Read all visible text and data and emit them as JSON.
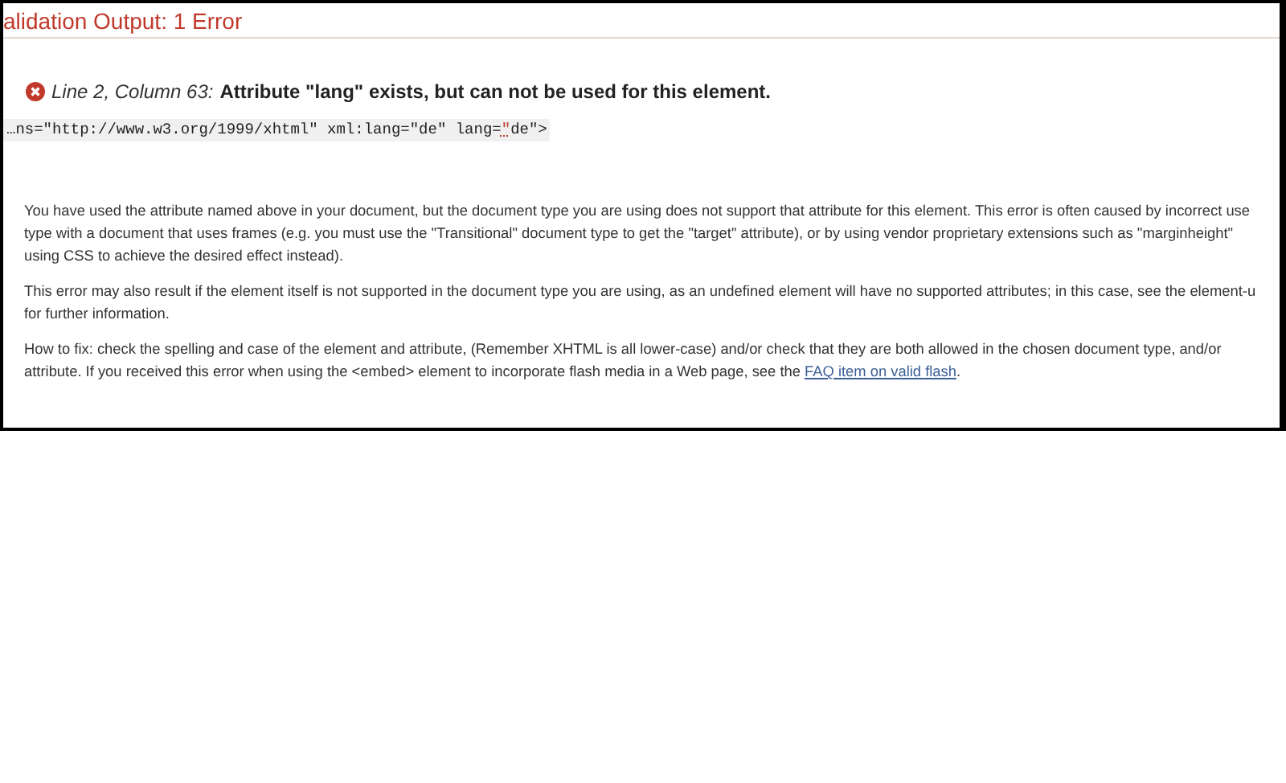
{
  "panel": {
    "title": "alidation Output: 1 Error"
  },
  "error": {
    "location": "Line 2, Column 63:",
    "message": "Attribute \"lang\" exists, but can not be used for this element.",
    "code_before": "…ns=\"http://www.w3.org/1999/xhtml\" xml:lang=\"de\" lang=",
    "code_highlight": "\"",
    "code_after": "de\">"
  },
  "paragraphs": [
    {
      "lines": [
        "You have used the attribute named above in your document, but the document type you are using does not support that attribute for this element. This error is often caused by incorrect use",
        "type with a document that uses frames (e.g. you must use the \"Transitional\" document type to get the \"target\" attribute), or by using vendor proprietary extensions such as \"marginheight\"",
        "using CSS to achieve the desired effect instead)."
      ]
    },
    {
      "lines": [
        "This error may also result if the element itself is not supported in the document type you are using, as an undefined element will have no supported attributes; in this case, see the element-u",
        "for further information."
      ]
    },
    {
      "lines": [
        "How to fix: check the spelling and case of the element and attribute, (Remember XHTML is all lower-case) and/or check that they are both allowed in the chosen document type, and/or"
      ],
      "last_line": "attribute. If you received this error when using the <embed> element to incorporate flash media in a Web page, see the ",
      "link": "FAQ item on valid flash",
      "after_link": "."
    }
  ]
}
